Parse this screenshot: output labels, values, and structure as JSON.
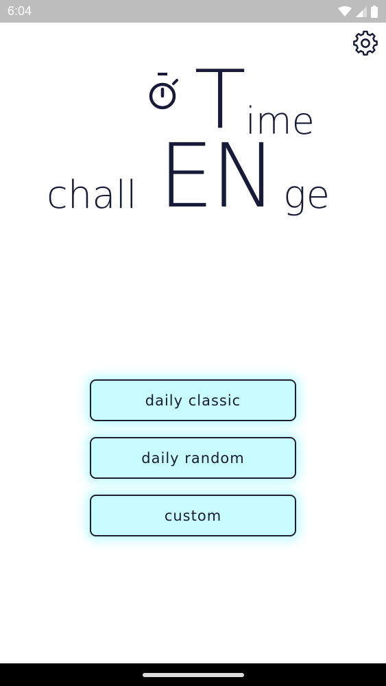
{
  "status_bar": {
    "time": "6:04",
    "icons": [
      "wifi-icon",
      "signal-icon",
      "battery-icon"
    ]
  },
  "header": {
    "settings_icon": "gear-icon"
  },
  "logo": {
    "word_t": "T",
    "word_ime": "ime",
    "word_chall": "chall",
    "word_en": "EN",
    "word_ge": "ge",
    "icon": "stopwatch-icon"
  },
  "menu": {
    "buttons": [
      {
        "label": "daily classic"
      },
      {
        "label": "daily random"
      },
      {
        "label": "custom"
      }
    ]
  },
  "colors": {
    "text": "#171a38",
    "button_fill": "#c8fcff",
    "button_glow": "#78f5ff",
    "status_bar": "#bdbdbd"
  }
}
